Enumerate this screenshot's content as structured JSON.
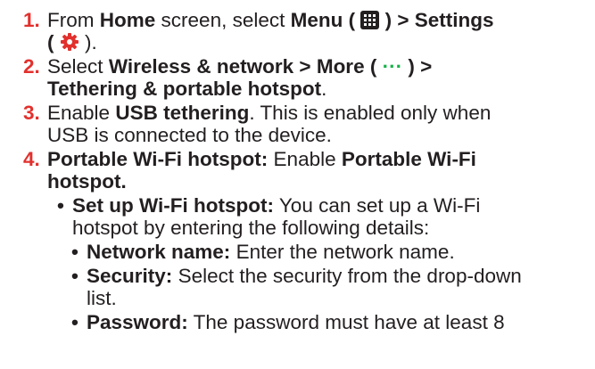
{
  "colors": {
    "step_number": "#e2302d",
    "text": "#231f20",
    "more_icon": "#19b24b",
    "gear_icon": "#e2302d"
  },
  "steps": [
    {
      "number": "1.",
      "from": "From",
      "home": "Home",
      "screen_select": "screen, select",
      "menu_open": "Menu (",
      "menu_close": ") > Settings",
      "gear_open": "(",
      "gear_close": ")."
    },
    {
      "number": "2.",
      "select": "Select",
      "path_open": "Wireless & network > More (",
      "path_close": ") >",
      "tethering": "Tethering & portable hotspot",
      "period": "."
    },
    {
      "number": "3.",
      "enable": "Enable",
      "usb": "USB tethering",
      "rest1": ". This is enabled only when",
      "rest2": "USB is connected to the device."
    },
    {
      "number": "4.",
      "label": "Portable Wi-Fi hotspot:",
      "enable": "Enable",
      "target1": "Portable Wi-Fi",
      "target2": "hotspot."
    }
  ],
  "bullets": {
    "setup": {
      "label": "Set up Wi-Fi hotspot:",
      "text1": "You can set up a Wi-Fi",
      "text2": "hotspot by entering the following details:"
    },
    "network": {
      "label": "Network name:",
      "text": "Enter the network name."
    },
    "security": {
      "label": "Security:",
      "text1": "Select the security from the drop-down",
      "text2": "list."
    },
    "password": {
      "label": "Password:",
      "text": "The password must have at least 8"
    }
  },
  "icons": {
    "menu": "menu-grid-icon",
    "settings": "gear-icon",
    "more": "more-dots-icon",
    "bullet": "•"
  }
}
